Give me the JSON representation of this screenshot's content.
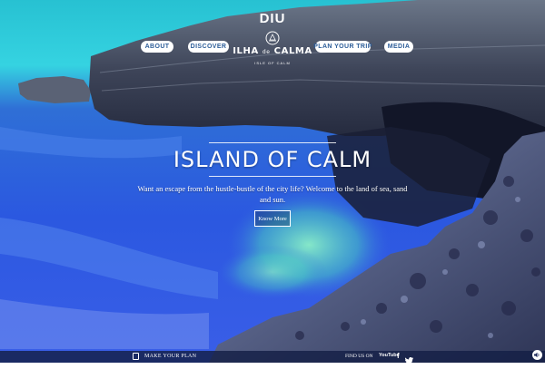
{
  "header": {
    "nav_left": [
      {
        "label": "ABOUT"
      },
      {
        "label": "DISCOVER"
      }
    ],
    "nav_right": [
      {
        "label": "PLAN YOUR TRIP"
      },
      {
        "label": "MEDIA"
      }
    ],
    "logo": {
      "top": "DIU",
      "main_pre": "ILHA ",
      "main_small": "de",
      "main_post": " CALMA",
      "sub": "ISLE OF CALM"
    }
  },
  "hero": {
    "title": "ISLAND OF CALM",
    "description": "Want an escape from the hustle-bustle of the city life? Welcome to the land of sea, sand and sun.",
    "cta_label": "Know More"
  },
  "footer": {
    "plan_label": "MAKE YOUR PLAN",
    "find_label": "FIND US ON",
    "youtube_label": "YouTube",
    "facebook_label": "f"
  },
  "icons": [
    "emblem-icon",
    "calendar-icon",
    "youtube-icon",
    "facebook-icon",
    "twitter-icon",
    "sound-icon"
  ],
  "colors": {
    "pill_text": "#2f5f9a",
    "sky": "#35d3e1",
    "sea": "#2b58e0",
    "footer_bar": "#141e46"
  }
}
